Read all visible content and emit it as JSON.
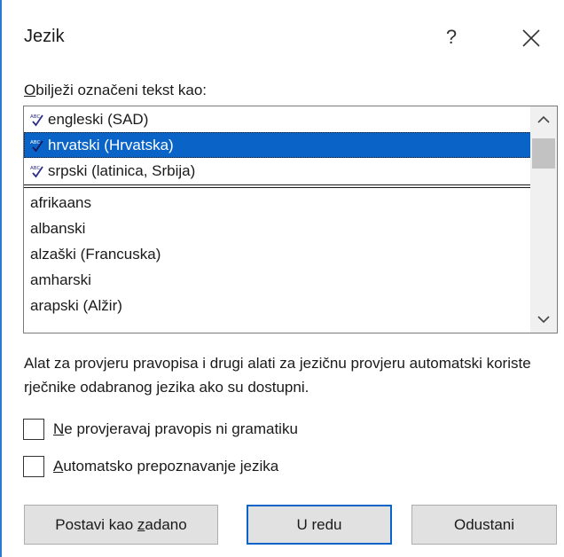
{
  "dialog": {
    "title": "Jezik",
    "help_label": "?",
    "close_icon": "close-icon"
  },
  "list": {
    "label_access_key": "O",
    "label_rest": "bilježi označeni tekst kao:",
    "top_items": [
      {
        "label": "engleski (SAD)",
        "icon": "spellcheck-icon",
        "selected": false
      },
      {
        "label": "hrvatski (Hrvatska)",
        "icon": "spellcheck-icon",
        "selected": true
      },
      {
        "label": "srpski (latinica, Srbija)",
        "icon": "spellcheck-icon",
        "selected": false
      }
    ],
    "items": [
      {
        "label": "afrikaans"
      },
      {
        "label": "albanski"
      },
      {
        "label": "alzaški (Francuska)"
      },
      {
        "label": "amharski"
      },
      {
        "label": "arapski (Alžir)"
      }
    ]
  },
  "description": "Alat za provjeru pravopisa i drugi alati za jezičnu provjeru automatski koriste rječnike odabranog jezika ako su dostupni.",
  "checkboxes": {
    "no_proofing": {
      "access_key": "N",
      "rest": "e provjeravaj pravopis ni gramatiku",
      "checked": false
    },
    "auto_detect": {
      "access_key": "A",
      "rest": "utomatsko prepoznavanje jezika",
      "checked": false
    }
  },
  "buttons": {
    "set_default_prefix": "Postavi kao ",
    "set_default_key": "z",
    "set_default_suffix": "adano",
    "ok": "U redu",
    "cancel": "Odustani"
  },
  "colors": {
    "selection": "#0a64c8",
    "accent_edge": "#2b78d0",
    "button_face": "#e1e1e1"
  }
}
